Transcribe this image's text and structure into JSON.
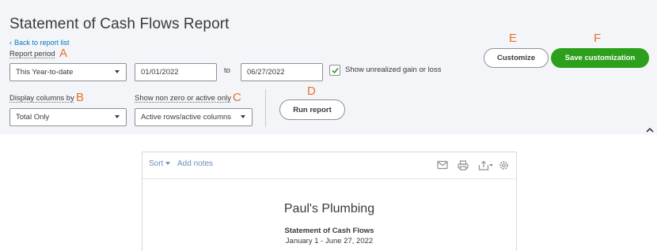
{
  "header": {
    "title": "Statement of Cash Flows Report",
    "back_link": "Back to report list"
  },
  "report_period": {
    "label": "Report period",
    "selected": "This Year-to-date",
    "start_date": "01/01/2022",
    "to_label": "to",
    "end_date": "06/27/2022",
    "unrealized_checkbox_checked": true,
    "unrealized_label": "Show unrealized gain or loss"
  },
  "display_columns": {
    "label": "Display columns by",
    "selected": "Total Only"
  },
  "non_zero": {
    "label": "Show non zero or active only",
    "selected": "Active rows/active columns"
  },
  "buttons": {
    "run_report": "Run report",
    "customize": "Customize",
    "save_customization": "Save customization"
  },
  "annotations": {
    "a": "A",
    "b": "B",
    "c": "C",
    "d": "D",
    "e": "E",
    "f": "F"
  },
  "report_toolbar": {
    "sort": "Sort",
    "add_notes": "Add notes",
    "icons": [
      "email-icon",
      "print-icon",
      "export-icon",
      "settings-icon"
    ]
  },
  "report": {
    "company": "Paul's Plumbing",
    "title": "Statement of Cash Flows",
    "dates": "January 1 - June 27, 2022"
  },
  "colors": {
    "accent_green": "#2ca01c",
    "link_blue": "#0077c5",
    "annotation_orange": "#e8712b",
    "panel_bg": "#f4f5f8"
  }
}
